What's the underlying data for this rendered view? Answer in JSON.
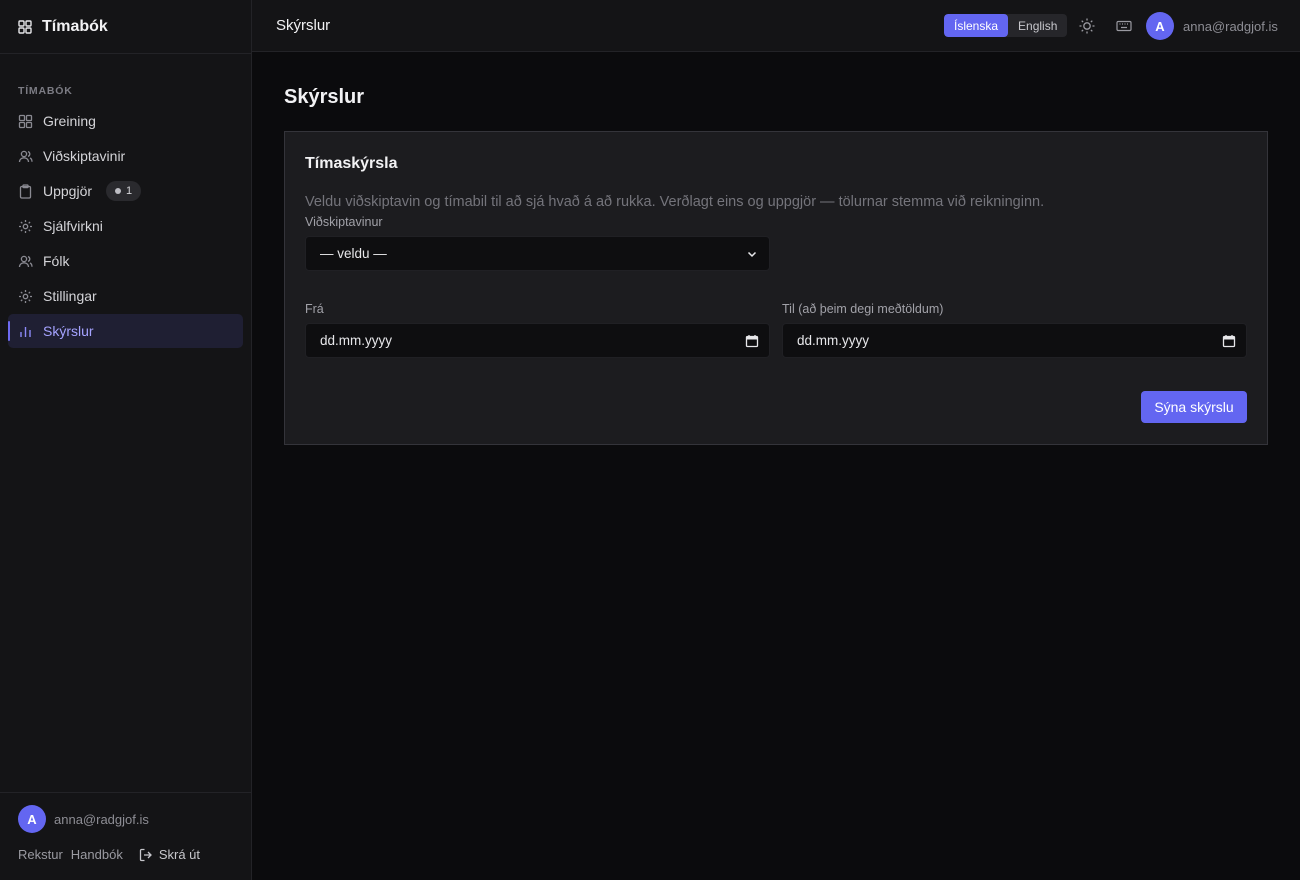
{
  "app": {
    "title": "Tímabók"
  },
  "sidebar": {
    "section_label": "TÍMABÓK",
    "items": [
      {
        "label": "Greining",
        "icon": "grid-icon"
      },
      {
        "label": "Viðskiptavinir",
        "icon": "users-icon"
      },
      {
        "label": "Uppgjör",
        "icon": "clipboard-icon",
        "badge": "1"
      },
      {
        "label": "Sjálfvirkni",
        "icon": "gear-icon"
      },
      {
        "label": "Fólk",
        "icon": "users-icon"
      },
      {
        "label": "Stillingar",
        "icon": "gear-icon"
      },
      {
        "label": "Skýrslur",
        "icon": "bar-chart-icon",
        "active": true
      }
    ],
    "footer": {
      "avatar_initial": "A",
      "email": "anna@radgjof.is",
      "links": [
        "Rekstur",
        "Handbók"
      ],
      "logout": "Skrá út"
    }
  },
  "topbar": {
    "title": "Skýrslur",
    "languages": [
      {
        "label": "Íslenska",
        "active": true
      },
      {
        "label": "English",
        "active": false
      }
    ],
    "avatar_initial": "A",
    "email": "anna@radgjof.is"
  },
  "main": {
    "page_title": "Skýrslur",
    "card": {
      "title": "Tímaskýrsla",
      "description": "Veldu viðskiptavin og tímabil til að sjá hvað á að rukka. Verðlagt eins og uppgjör — tölurnar stemma við reikninginn.",
      "client_label": "Viðskiptavinur",
      "client_value": "— veldu —",
      "from_label": "Frá",
      "from_value": "dd.mm.yyyy",
      "to_label": "Til (að þeim degi meðtöldum)",
      "to_value": "dd.mm.yyyy",
      "submit_label": "Sýna skýrslu"
    }
  },
  "colors": {
    "accent": "#6366f1",
    "background": "#0b0b0d",
    "sidebar": "#141416",
    "card": "#1c1c1f"
  }
}
